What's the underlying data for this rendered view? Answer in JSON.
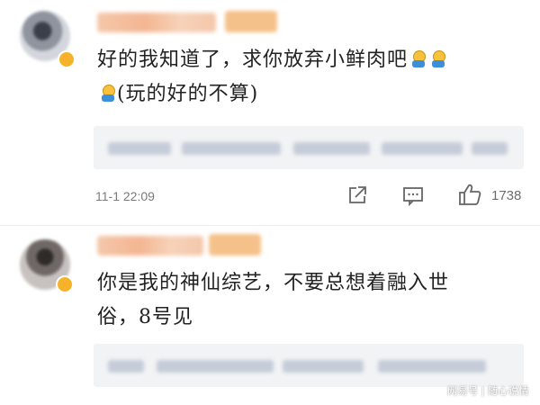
{
  "comments": [
    {
      "text_line1": "好的我知道了，求你放弃小鲜肉吧",
      "text_line2": "(玩的好的不算)",
      "emoji_names": [
        "pray-emoji",
        "pray-emoji",
        "pray-emoji"
      ],
      "timestamp": "11-1 22:09",
      "like_count": "1738"
    },
    {
      "text_line1": "你是我的神仙综艺，不要总想着融入世",
      "text_line2": "俗，8号见"
    }
  ],
  "watermark": "网易号 | 随心说情",
  "colors": {
    "text": "#222222",
    "meta": "#7b7b7b",
    "reply_bg": "#f2f3f5",
    "badge": "#f5b22a"
  },
  "icons": [
    "share-icon",
    "comment-icon",
    "like-icon"
  ]
}
